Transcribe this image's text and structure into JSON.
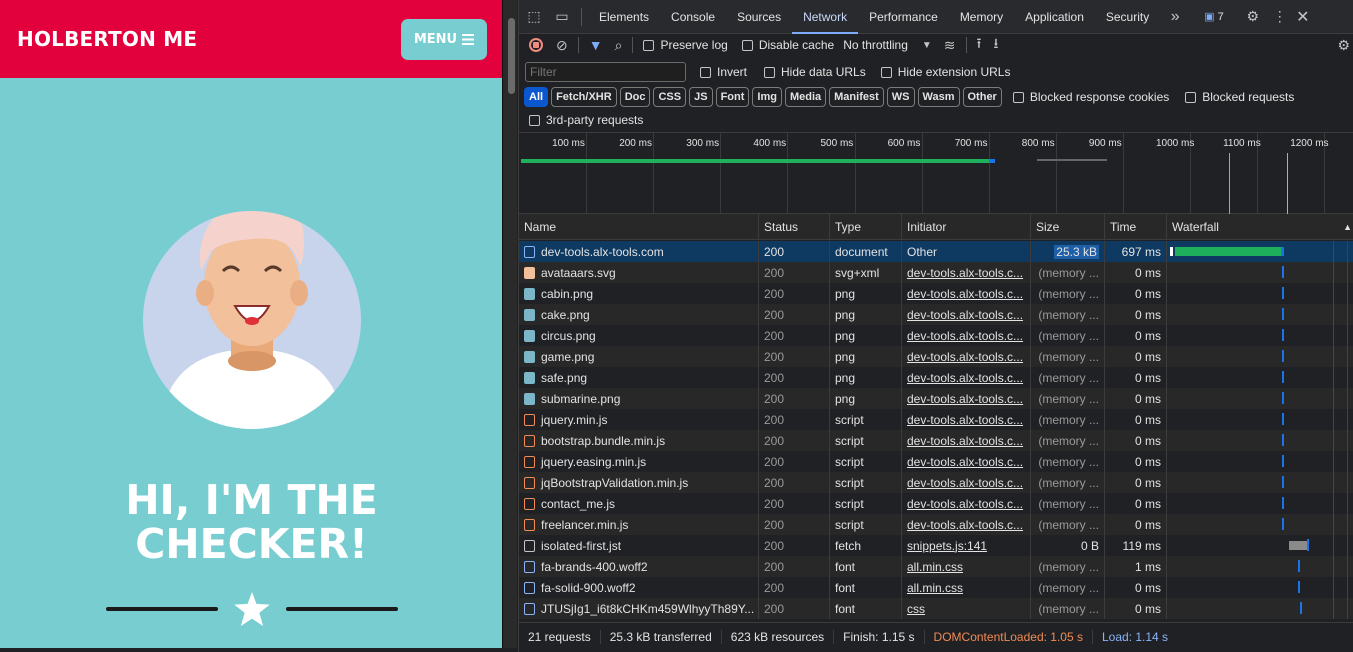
{
  "site": {
    "brand": "HOLBERTON ME",
    "menu_label": "MENU",
    "headline_line1": "HI, I'M THE",
    "headline_line2": "CHECKER!"
  },
  "devtools": {
    "tabs": [
      "Elements",
      "Console",
      "Sources",
      "Network",
      "Performance",
      "Memory",
      "Application",
      "Security"
    ],
    "active_tab": "Network",
    "issues_count": "7",
    "toolbar": {
      "preserve_log": "Preserve log",
      "disable_cache": "Disable cache",
      "throttling": "No throttling"
    },
    "filter": {
      "placeholder": "Filter",
      "invert": "Invert",
      "hide_data_urls": "Hide data URLs",
      "hide_extension_urls": "Hide extension URLs"
    },
    "type_filters": [
      "All",
      "Fetch/XHR",
      "Doc",
      "CSS",
      "JS",
      "Font",
      "Img",
      "Media",
      "Manifest",
      "WS",
      "Wasm",
      "Other"
    ],
    "blocked_response_cookies": "Blocked response cookies",
    "blocked_requests": "Blocked requests",
    "third_party": "3rd-party requests",
    "overview_ticks": [
      "100 ms",
      "200 ms",
      "300 ms",
      "400 ms",
      "500 ms",
      "600 ms",
      "700 ms",
      "800 ms",
      "900 ms",
      "1000 ms",
      "1100 ms",
      "1200 ms"
    ],
    "columns": {
      "name": "Name",
      "status": "Status",
      "type": "Type",
      "initiator": "Initiator",
      "size": "Size",
      "time": "Time",
      "waterfall": "Waterfall"
    },
    "requests": [
      {
        "name": "dev-tools.alx-tools.com",
        "status": "200",
        "type": "document",
        "initiator": "Other",
        "size": "25.3 kB",
        "time": "697 ms",
        "icon": "doc-icon"
      },
      {
        "name": "avataaars.svg",
        "status": "200",
        "type": "svg+xml",
        "initiator": "dev-tools.alx-tools.c...",
        "size": "(memory ...",
        "time": "0 ms",
        "icon": "avatar-img-icon"
      },
      {
        "name": "cabin.png",
        "status": "200",
        "type": "png",
        "initiator": "dev-tools.alx-tools.c...",
        "size": "(memory ...",
        "time": "0 ms",
        "icon": "image-icon"
      },
      {
        "name": "cake.png",
        "status": "200",
        "type": "png",
        "initiator": "dev-tools.alx-tools.c...",
        "size": "(memory ...",
        "time": "0 ms",
        "icon": "image-icon"
      },
      {
        "name": "circus.png",
        "status": "200",
        "type": "png",
        "initiator": "dev-tools.alx-tools.c...",
        "size": "(memory ...",
        "time": "0 ms",
        "icon": "image-icon"
      },
      {
        "name": "game.png",
        "status": "200",
        "type": "png",
        "initiator": "dev-tools.alx-tools.c...",
        "size": "(memory ...",
        "time": "0 ms",
        "icon": "image-icon"
      },
      {
        "name": "safe.png",
        "status": "200",
        "type": "png",
        "initiator": "dev-tools.alx-tools.c...",
        "size": "(memory ...",
        "time": "0 ms",
        "icon": "image-icon"
      },
      {
        "name": "submarine.png",
        "status": "200",
        "type": "png",
        "initiator": "dev-tools.alx-tools.c...",
        "size": "(memory ...",
        "time": "0 ms",
        "icon": "image-icon"
      },
      {
        "name": "jquery.min.js",
        "status": "200",
        "type": "script",
        "initiator": "dev-tools.alx-tools.c...",
        "size": "(memory ...",
        "time": "0 ms",
        "icon": "script-icon"
      },
      {
        "name": "bootstrap.bundle.min.js",
        "status": "200",
        "type": "script",
        "initiator": "dev-tools.alx-tools.c...",
        "size": "(memory ...",
        "time": "0 ms",
        "icon": "script-icon"
      },
      {
        "name": "jquery.easing.min.js",
        "status": "200",
        "type": "script",
        "initiator": "dev-tools.alx-tools.c...",
        "size": "(memory ...",
        "time": "0 ms",
        "icon": "script-icon"
      },
      {
        "name": "jqBootstrapValidation.min.js",
        "status": "200",
        "type": "script",
        "initiator": "dev-tools.alx-tools.c...",
        "size": "(memory ...",
        "time": "0 ms",
        "icon": "script-icon"
      },
      {
        "name": "contact_me.js",
        "status": "200",
        "type": "script",
        "initiator": "dev-tools.alx-tools.c...",
        "size": "(memory ...",
        "time": "0 ms",
        "icon": "script-icon"
      },
      {
        "name": "freelancer.min.js",
        "status": "200",
        "type": "script",
        "initiator": "dev-tools.alx-tools.c...",
        "size": "(memory ...",
        "time": "0 ms",
        "icon": "script-icon"
      },
      {
        "name": "isolated-first.jst",
        "status": "200",
        "type": "fetch",
        "initiator": "snippets.js:141",
        "size": "0 B",
        "time": "119 ms",
        "icon": "file-icon"
      },
      {
        "name": "fa-brands-400.woff2",
        "status": "200",
        "type": "font",
        "initiator": "all.min.css",
        "size": "(memory ...",
        "time": "1 ms",
        "icon": "font-icon"
      },
      {
        "name": "fa-solid-900.woff2",
        "status": "200",
        "type": "font",
        "initiator": "all.min.css",
        "size": "(memory ...",
        "time": "0 ms",
        "icon": "font-icon"
      },
      {
        "name": "JTUSjIg1_i6t8kCHKm459WlhyyTh89Y...",
        "status": "200",
        "type": "font",
        "initiator": "css",
        "size": "(memory ...",
        "time": "0 ms",
        "icon": "font-icon"
      }
    ],
    "status_bar": {
      "requests": "21 requests",
      "transferred": "25.3 kB transferred",
      "resources": "623 kB resources",
      "finish": "Finish: 1.15 s",
      "dom_content_loaded": "DOMContentLoaded: 1.05 s",
      "load": "Load: 1.14 s"
    },
    "colors": {
      "accent": "#7cacf8",
      "dcl": "#f28b54",
      "load": "#8ab4f8",
      "bar_green": "#1fb05c",
      "selected_row": "#0e3a62"
    }
  }
}
